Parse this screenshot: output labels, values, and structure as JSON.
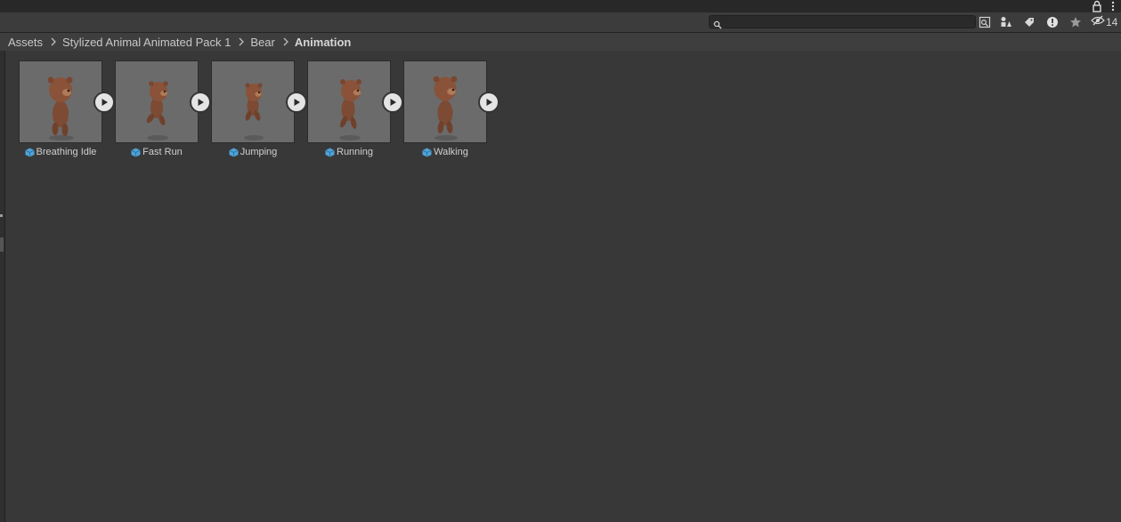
{
  "toolbar": {
    "search": {
      "value": "",
      "placeholder": ""
    },
    "hidden_count": "14"
  },
  "breadcrumb": {
    "items": [
      "Assets",
      "Stylized Animal Animated Pack 1",
      "Bear"
    ],
    "current": "Animation"
  },
  "assets": [
    {
      "name": "Breathing Idle",
      "type_icon": "model-prefab-icon"
    },
    {
      "name": "Fast Run",
      "type_icon": "model-prefab-icon"
    },
    {
      "name": "Jumping",
      "type_icon": "model-prefab-icon"
    },
    {
      "name": "Running",
      "type_icon": "model-prefab-icon"
    },
    {
      "name": "Walking",
      "type_icon": "model-prefab-icon"
    }
  ],
  "colors": {
    "background": "#383838",
    "thumbnail_bg": "#6b6b6b",
    "bear": "#8a5238",
    "play_button": "#e4e4e4"
  }
}
